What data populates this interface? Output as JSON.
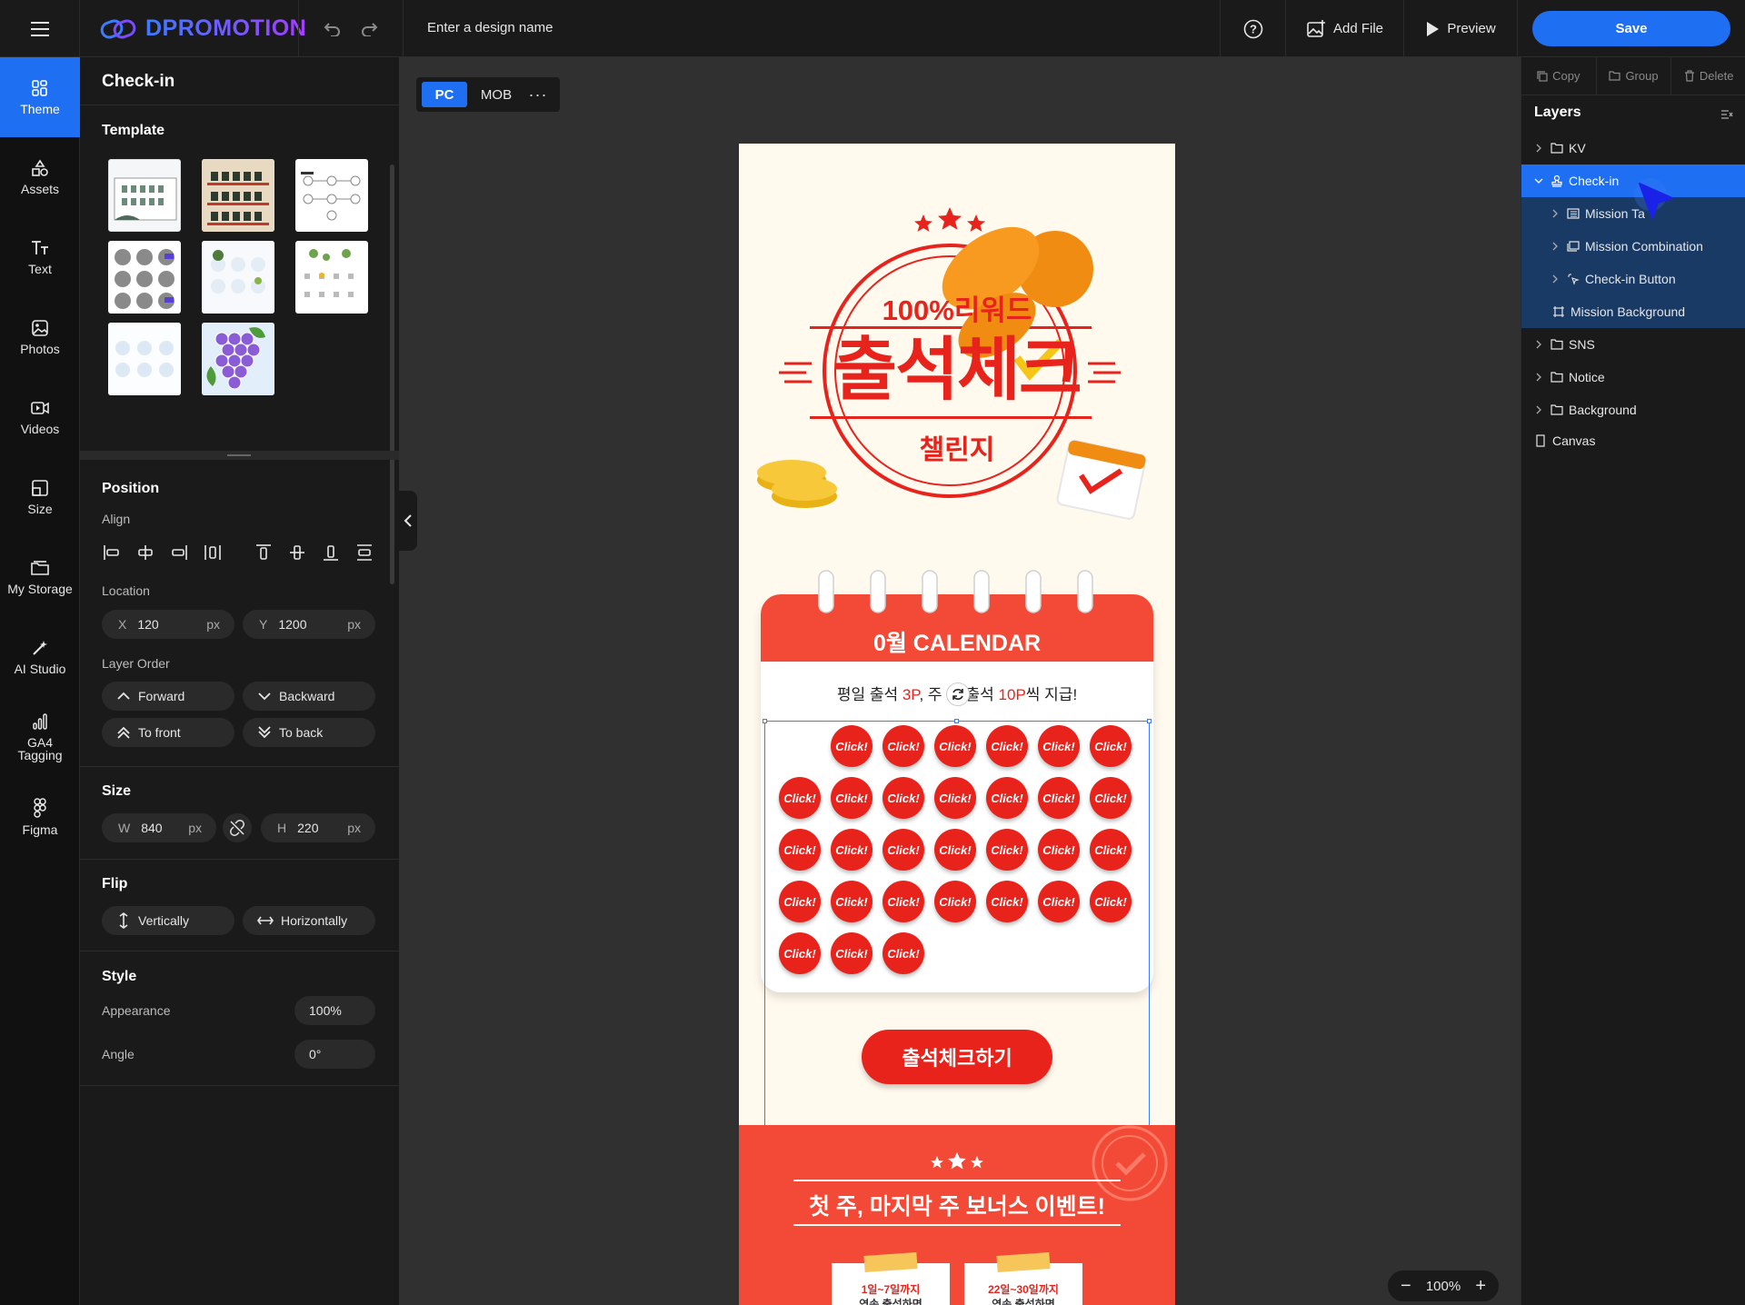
{
  "app": {
    "name": "DPROMOTION",
    "design_name_placeholder": "Enter a design name"
  },
  "toolbar": {
    "add_file": "Add File",
    "preview": "Preview",
    "save": "Save"
  },
  "sidebar": {
    "items": [
      {
        "label": "Theme",
        "icon": "theme-icon"
      },
      {
        "label": "Assets",
        "icon": "assets-icon"
      },
      {
        "label": "Text",
        "icon": "text-icon"
      },
      {
        "label": "Photos",
        "icon": "photos-icon"
      },
      {
        "label": "Videos",
        "icon": "videos-icon"
      },
      {
        "label": "Size",
        "icon": "size-icon"
      },
      {
        "label": "My Storage",
        "icon": "storage-icon"
      },
      {
        "label": "AI Studio",
        "icon": "ai-studio-icon"
      },
      {
        "label": "GA4 Tagging",
        "icon": "ga4-icon"
      },
      {
        "label": "Figma",
        "icon": "figma-icon"
      }
    ]
  },
  "panel": {
    "title": "Check-in",
    "template_title": "Template",
    "position_title": "Position",
    "align_label": "Align",
    "location_label": "Location",
    "x_label": "X",
    "x_value": "120",
    "y_label": "Y",
    "y_value": "1200",
    "unit": "px",
    "layer_order_label": "Layer Order",
    "forward": "Forward",
    "backward": "Backward",
    "to_front": "To front",
    "to_back": "To back",
    "size_title": "Size",
    "w_label": "W",
    "w_value": "840",
    "h_label": "H",
    "h_value": "220",
    "flip_title": "Flip",
    "vertically": "Vertically",
    "horizontally": "Horizontally",
    "style_title": "Style",
    "appearance_label": "Appearance",
    "appearance_value": "100%",
    "angle_label": "Angle",
    "angle_value": "0°"
  },
  "canvas": {
    "device_pc": "PC",
    "device_mob": "MOB",
    "more": "···",
    "zoom": "100%",
    "art": {
      "reward": "100%리워드",
      "headline": "출석체크",
      "challenge": "챌린지",
      "calendar_title": "0월 CALENDAR",
      "subtitle_a": "평일 출석 ",
      "subtitle_b": "3P",
      "subtitle_c": ", 주",
      "subtitle_d": "출석 ",
      "subtitle_e": "10P",
      "subtitle_f": "씩 지급!",
      "click": "Click!",
      "checkin_button": "출석체크하기",
      "bonus_title": "첫 주, 마지막 주 보너스 이벤트!",
      "card1": "1일~7일까지",
      "card1_sub": "연속 출석하면",
      "card2": "22일~30일까지",
      "card2_sub": "연속 출석하면"
    }
  },
  "layers": {
    "copy": "Copy",
    "group": "Group",
    "delete": "Delete",
    "title": "Layers",
    "items": [
      {
        "label": "KV"
      },
      {
        "label": "Check-in"
      },
      {
        "label": "Mission Ta"
      },
      {
        "label": "Mission Combination"
      },
      {
        "label": "Check-in Button"
      },
      {
        "label": "Mission Background"
      },
      {
        "label": "SNS"
      },
      {
        "label": "Notice"
      },
      {
        "label": "Background"
      },
      {
        "label": "Canvas"
      }
    ]
  }
}
